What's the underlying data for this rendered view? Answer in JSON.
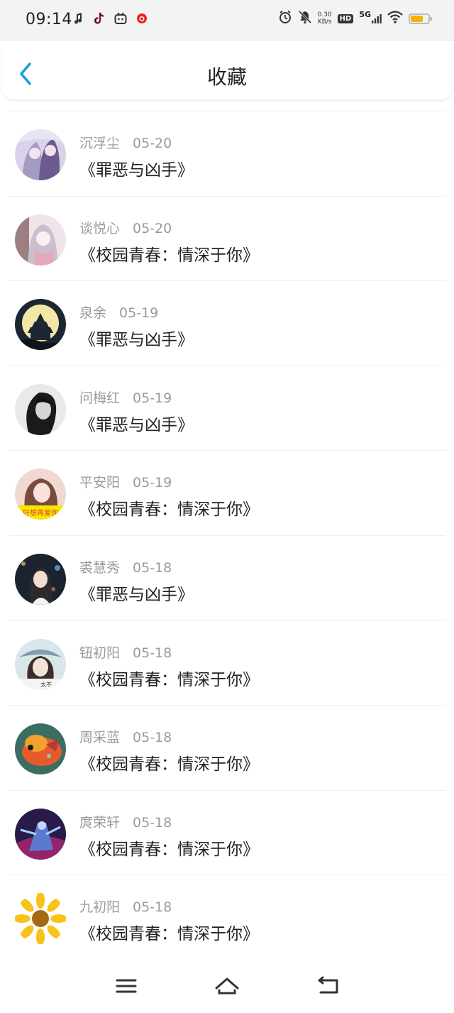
{
  "status": {
    "time": "09:14",
    "net_speed_value": "0.30",
    "net_speed_unit": "KB/s",
    "hd_label": "HD",
    "network_label": "5G",
    "battery_level": 0.72,
    "left_icons": [
      "music-app-icon",
      "tiktok-icon",
      "bilibili-icon",
      "netease-music-icon"
    ],
    "right_icons": [
      "alarm-icon",
      "mute-icon",
      "wifi-icon",
      "battery-icon"
    ]
  },
  "header": {
    "title": "收藏",
    "back_icon": "chevron-left-icon",
    "accent_color": "#1a9be8"
  },
  "items": [
    {
      "name": "沉浮尘",
      "date": "05-20",
      "book": "《罪恶与凶手》",
      "avatar": "anime-girls-avatar"
    },
    {
      "name": "谈悦心",
      "date": "05-20",
      "book": "《校园青春：情深于你》",
      "avatar": "anime-girl-avatar"
    },
    {
      "name": "泉余",
      "date": "05-19",
      "book": "《罪恶与凶手》",
      "avatar": "pagoda-moon-avatar"
    },
    {
      "name": "问梅红",
      "date": "05-19",
      "book": "《罪恶与凶手》",
      "avatar": "bw-woman-avatar"
    },
    {
      "name": "平安阳",
      "date": "05-19",
      "book": "《校园青春：情深于你》",
      "avatar": "girl-caption-avatar",
      "avatar_caption": "好想再爱你"
    },
    {
      "name": "裘慧秀",
      "date": "05-18",
      "book": "《罪恶与凶手》",
      "avatar": "woman-night-avatar"
    },
    {
      "name": "钮初阳",
      "date": "05-18",
      "book": "《校园青春：情深于你》",
      "avatar": "woman-hat-avatar",
      "avatar_caption": "太不"
    },
    {
      "name": "周采蓝",
      "date": "05-18",
      "book": "《校园青春：情深于你》",
      "avatar": "goldfish-avatar"
    },
    {
      "name": "庹荣轩",
      "date": "05-18",
      "book": "《校园青春：情深于你》",
      "avatar": "game-character-avatar"
    },
    {
      "name": "九初阳",
      "date": "05-18",
      "book": "《校园青春：情深于你》",
      "avatar": "sunflower-avatar"
    }
  ],
  "navbar": {
    "buttons": [
      "menu-icon",
      "home-icon",
      "back-icon"
    ]
  }
}
